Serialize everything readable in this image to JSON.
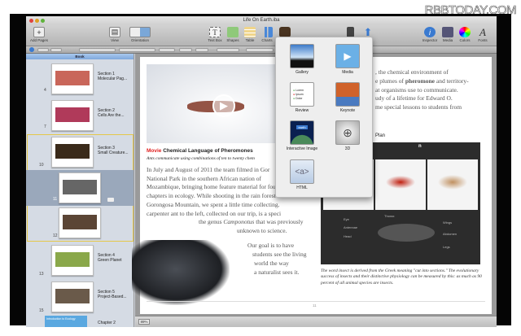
{
  "watermark": "RBBTODAY.COM",
  "window": {
    "title": "Life On Earth.iba"
  },
  "toolbar": {
    "left": [
      {
        "label": "Add Pages",
        "icon": "plus-icon"
      },
      {
        "label": "View",
        "icon": "view-icon"
      },
      {
        "label": "Orientation",
        "icon": "orientation-icon"
      }
    ],
    "center": [
      {
        "label": "Text Box",
        "icon": "text-box-icon"
      },
      {
        "label": "Shapes",
        "icon": "shapes-icon"
      },
      {
        "label": "Table",
        "icon": "table-icon"
      },
      {
        "label": "Charts",
        "icon": "charts-icon"
      }
    ],
    "right": [
      {
        "label": "Inspector",
        "icon": "info-icon"
      },
      {
        "label": "Media",
        "icon": "media-icon"
      },
      {
        "label": "Colors",
        "icon": "color-wheel-icon"
      },
      {
        "label": "Fonts",
        "icon": "fonts-icon"
      }
    ]
  },
  "sidebar": {
    "header": "Book",
    "sections": [
      {
        "title": "Section 1",
        "subtitle": "Molecular Pag...",
        "page": "4",
        "color": "#c9665a"
      },
      {
        "title": "Section 2",
        "subtitle": "Cells Are the...",
        "page": "7",
        "color": "#b03a5a"
      },
      {
        "title": "Section 3",
        "subtitle": "Small Creature...",
        "page": "10",
        "color": "#3a2a1a"
      },
      {
        "title": "",
        "subtitle": "",
        "page": "11",
        "color": "#666"
      },
      {
        "title": "",
        "subtitle": "",
        "page": "12",
        "color": "#5b4535"
      },
      {
        "title": "Section 4",
        "subtitle": "Green Planet",
        "page": "13",
        "color": "#8aa84a"
      },
      {
        "title": "Section 5",
        "subtitle": "Project-Based...",
        "page": "15",
        "color": "#6a5a4a"
      }
    ],
    "chapter": {
      "title": "Chapter 2",
      "thumb_text": "Introduction to Ecology"
    }
  },
  "page": {
    "movie_label": "Movie",
    "movie_title": "Chemical Language of Pheromones",
    "caption": "Ants communicate using combinations of ten to twenty chem",
    "body": [
      "In July and August of 2011 the team filmed in Gor",
      "National Park in the southern African nation of",
      "Mozambique, bringing home feature material for four",
      "chapters in ecology. While shooting in the rain forest atop",
      "Gorongosa Mountain, we spent a little time collecting. The",
      "carpenter ant to the left, collected on our trip, is a species of"
    ],
    "genus_pre": "the genus ",
    "genus": "Camponotus",
    "genus_post": " that was previously",
    "body2": "unknown to science.",
    "goal": [
      "Our goal is to have",
      "students see the living",
      "world the way",
      "a naturalist sees it."
    ],
    "right_text": [
      ", the chemical environment of",
      "e plumes of ",
      "pheromone",
      " and territory-",
      "at organisms use to communicate.",
      "udy of a lifetime for Edward O.",
      "me special lessons to students from"
    ],
    "plan_heading": "Plan",
    "panel_title": "n",
    "diagram_labels": [
      "Eye",
      "Antennae",
      "Head",
      "Thorax",
      "Wings",
      "Abdomen",
      "Legs"
    ],
    "figure_caption": "The word insect is derived from the Greek meaning \"cut into sections.\" The evolutionary success of insects and their distinctive physiology can be measured by this: as much as 90 percent of all animal species are insects.",
    "page_number": "11"
  },
  "bottombar": {
    "zoom": "89%"
  },
  "widgets": [
    {
      "label": "Gallery",
      "icon": "gallery-icon"
    },
    {
      "label": "Media",
      "icon": "media-play-icon"
    },
    {
      "label": "Review",
      "icon": "review-icon",
      "items": [
        "Lorem",
        "Ipsum",
        "Dolor"
      ]
    },
    {
      "label": "Keynote",
      "icon": "keynote-icon"
    },
    {
      "label": "Interactive Image",
      "icon": "interactive-image-icon",
      "tag": "earth"
    },
    {
      "label": "3D",
      "icon": "3d-icon"
    },
    {
      "label": "HTML",
      "icon": "html-icon",
      "glyph": "<a>"
    }
  ],
  "colors": {
    "accent": "#4a88d8",
    "movie_red": "#e02020",
    "selection": "#e5c84a"
  }
}
